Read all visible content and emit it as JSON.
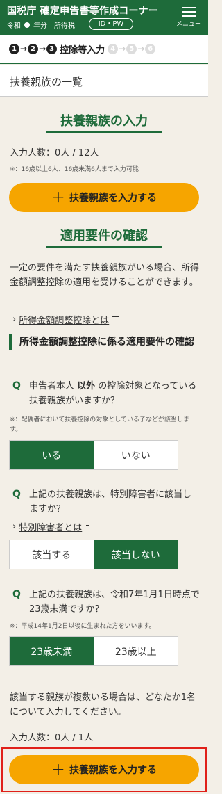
{
  "header": {
    "title": "国税庁 確定申告書等作成コーナー",
    "era": "令和",
    "year_label": "年分",
    "tax_label": "所得税",
    "id_pw": "ID・PW",
    "menu_label": "メニュー"
  },
  "steps": {
    "items": [
      "1",
      "2",
      "3",
      "4",
      "5",
      "6"
    ],
    "current_index": 3,
    "current_label": "控除等入力"
  },
  "page_title": "扶養親族の一覧",
  "dependents_section": {
    "heading": "扶養親族の入力",
    "count_text": "入力人数：0人 / 12人",
    "note": "※：16歳以上6人、16歳未満6人まで入力可能",
    "add_button": "扶養親族を入力する"
  },
  "requirements_section": {
    "heading": "適用要件の確認",
    "intro": "一定の要件を満たす扶養親族がいる場合、所得金額調整控除の適用を受けることができます。",
    "link1": "所得金額調整控除とは",
    "subheading": "所得金額調整控除に係る適用要件の確認",
    "q1": {
      "mark": "Q",
      "text_prefix": "申告者本人 ",
      "text_bold": "以外",
      "text_suffix": " の控除対象となっている扶養親族がいますか？",
      "note": "※：配偶者において扶養控除の対象としている子などが該当します。",
      "options": [
        "いる",
        "いない"
      ],
      "selected": "いる"
    },
    "q2": {
      "mark": "Q",
      "text": "上記の扶養親族は、特別障害者に該当しますか？",
      "link": "特別障害者とは",
      "options": [
        "該当する",
        "該当しない"
      ],
      "selected": "該当しない"
    },
    "q3": {
      "mark": "Q",
      "text": "上記の扶養親族は、令和7年1月1日時点で23歳未満ですか？",
      "note": "※：平成14年1月2日以後に生まれた方をいいます。",
      "options": [
        "23歳未満",
        "23歳以上"
      ],
      "selected": "23歳未満"
    },
    "multi_note": "該当する親族が複数いる場合は、どなたか1名について入力してください。",
    "count_text": "入力人数：0人 / 1人",
    "add_button": "扶養親族を入力する"
  },
  "colors": {
    "brand_green": "#1e6b3a",
    "accent_orange": "#f6a500",
    "highlight_red": "#e0201a",
    "background": "#f3efe7"
  },
  "icons": {
    "menu": "hamburger-icon",
    "external": "external-window-icon",
    "plus": "plus-icon",
    "chevron": "chevron-right-icon"
  }
}
